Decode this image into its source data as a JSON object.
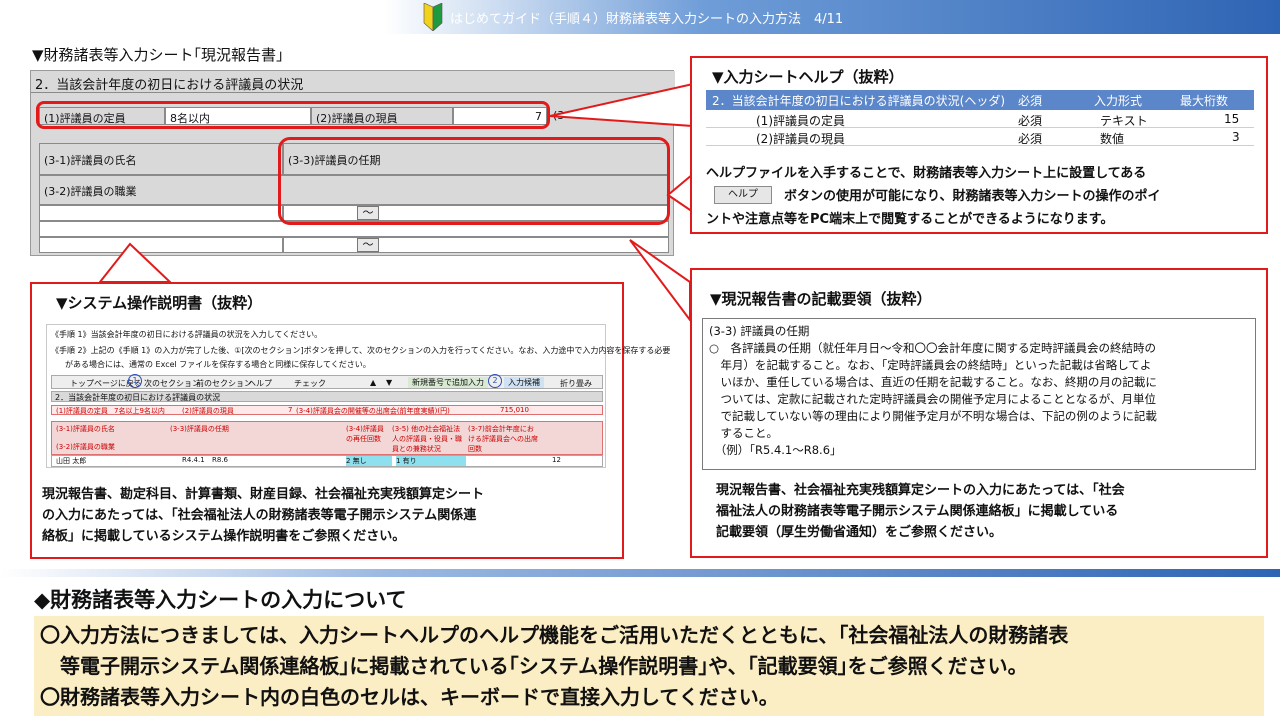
{
  "header": {
    "title": "はじめてガイド（手順４）財務諸表等入力シートの入力方法　4/11"
  },
  "sheet_section": {
    "label": "▼財務諸表等入力シート｢現況報告書｣",
    "title": "2．当該会計年度の初日における評議員の状況",
    "row1": {
      "label1": "(1)評議員の定員",
      "value1": "8名以内",
      "label2": "(2)評議員の現員",
      "value2": "7",
      "partial": "(3"
    },
    "name_label": "(3-1)評議員の氏名",
    "term_label": "(3-3)評議員の任期",
    "role_label": "(3-2)評議員の職業",
    "tilde": "～"
  },
  "help": {
    "title": "▼入力シートヘルプ（抜粋）",
    "table": {
      "header": [
        "2．当該会計年度の初日における評議員の状況(ヘッダ)",
        "必須",
        "入力形式",
        "最大桁数"
      ],
      "rows": [
        [
          "(1)評議員の定員",
          "必須",
          "テキスト",
          "15"
        ],
        [
          "(2)評議員の現員",
          "必須",
          "数値",
          "3"
        ]
      ]
    },
    "desc1": "ヘルプファイルを入手することで、財務諸表等入力シート上に設置してある",
    "button_label": "ヘルプ",
    "desc2": "ボタンの使用が可能になり、財務諸表等入力シートの操作のポイ",
    "desc3": "ントや注意点等をPC端末上で閲覧することができるようになります。"
  },
  "manual": {
    "title": "▼システム操作説明書（抜粋）",
    "shot": {
      "step1": "《手順 1》当該会計年度の初日における評議員の状況を入力してください。",
      "step2a": "《手順 2》上記の《手順 1》の入力が完了した後、①[次のセクション]ボタンを押して、次のセクションの入力を行ってください。なお、入力途中で入力内容を保存する必要",
      "step2b": "がある場合には、通常の Excel ファイルを保存する場合と同様に保存してください。",
      "buttons": [
        "トップページに戻る",
        "次のセクション",
        "前のセクション",
        "ヘルプ",
        "チェック",
        "▲",
        "▼",
        "新規番号で追加入力",
        "入力候補",
        "折り畳み"
      ],
      "circle1": "1",
      "circle2": "2",
      "sheet_title": "2．当該会計年度の初日における評議員の状況",
      "r1": [
        "(1)評議員の定員",
        "7名以上9名以内",
        "(2)評議員の現員",
        "7",
        "(3-4)評議員会の開催等の出席会(前年度実績)(円)",
        "715,010"
      ],
      "r2": [
        "(3-1)評議員の氏名",
        "(3-3)評議員の任期",
        "(3-4)評議員の再任回数",
        "(3-5) 他の社会福祉法人の評議員・役員・職員との兼務状況",
        "(3-7)前会計年度における評議員会への出席回数"
      ],
      "r3": "(3-2)評議員の職業",
      "r4": [
        "山田 太郎",
        "R4.4.1",
        "R8.6",
        "2 無し",
        "1 有り",
        "12"
      ]
    },
    "desc": [
      "現況報告書、勘定科目、計算書類、財産目録、社会福祉充実残額算定シート",
      "の入力にあたっては、「社会福祉法人の財務諸表等電子開示システム関係連",
      "絡板」に掲載しているシステム操作説明書をご参照ください。"
    ]
  },
  "guide": {
    "title": "▼現況報告書の記載要領（抜粋）",
    "lines": [
      "(3-3) 評議員の任期",
      "○　各評議員の任期（就任年月日～令和〇〇会計年度に関する定時評議員会の終結時の",
      "　年月）を記載すること。なお、「定時評議員会の終結時」といった記載は省略してよ",
      "　いほか、重任している場合は、直近の任期を記載すること。なお、終期の月の記載に",
      "　ついては、定款に記載された定時評議員会の開催予定月によることとなるが、月単位",
      "　で記載していない等の理由により開催予定月が不明な場合は、下記の例のように記載",
      "　すること。",
      "　（例）「R5.4.1～R8.6」"
    ],
    "desc": [
      "現況報告書、社会福祉充実残額算定シートの入力にあたっては、「社会",
      "福祉法人の財務諸表等電子開示システム関係連絡板」に掲載している",
      "記載要領（厚生労働省通知）をご参照ください。"
    ]
  },
  "about": {
    "title": "◆財務諸表等入力シートの入力について",
    "lines": [
      "〇入力方法につきましては、入力シートヘルプのヘルプ機能をご活用いただくとともに、｢社会福祉法人の財務諸表",
      "　等電子開示システム関係連絡板｣に掲載されている｢システム操作説明書｣や、｢記載要領｣をご参照ください。",
      "〇財務諸表等入力シート内の白色のセルは、キーボードで直接入力してください。"
    ]
  },
  "colors": {
    "accent_red": "#e11b1b",
    "header_blue": "#2e64b4",
    "table_head_blue": "#5b86c9",
    "highlight_yellow": "#fbedc4"
  }
}
